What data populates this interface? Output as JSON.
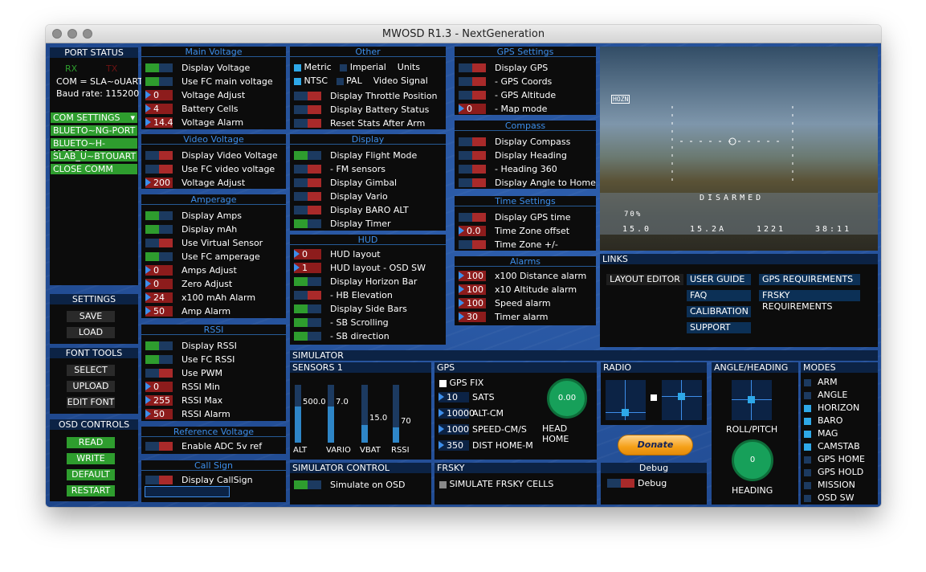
{
  "window": {
    "title": "MWOSD R1.3 - NextGeneration"
  },
  "port": {
    "title": "PORT STATUS",
    "rx": "RX",
    "tx": "TX",
    "com": "COM = SLA~oUART",
    "baud": "Baud rate: 115200",
    "com_settings": "COM SETTINGS",
    "ports": [
      "BLUETO~NG-PORT",
      "BLUETO~H-MODEM",
      "SLAB_U~BTOUART",
      "CLOSE COMM"
    ]
  },
  "settings": {
    "title": "SETTINGS",
    "save": "SAVE",
    "load": "LOAD"
  },
  "font_tools": {
    "title": "FONT TOOLS",
    "select": "SELECT",
    "upload": "UPLOAD",
    "edit": "EDIT FONT"
  },
  "osd_controls": {
    "title": "OSD CONTROLS",
    "read": "READ",
    "write": "WRITE",
    "default": "DEFAULT",
    "restart": "RESTART"
  },
  "main_voltage": {
    "title": "Main Voltage",
    "rows": [
      {
        "label": "Display Voltage",
        "state": "on"
      },
      {
        "label": "Use FC main voltage",
        "state": "on"
      },
      {
        "label": "Voltage Adjust",
        "value": "0"
      },
      {
        "label": "Battery Cells",
        "value": "4"
      },
      {
        "label": "Voltage Alarm",
        "value": "14.4"
      }
    ]
  },
  "video_voltage": {
    "title": "Video Voltage",
    "rows": [
      {
        "label": "Display Video Voltage",
        "state": "off"
      },
      {
        "label": "Use FC video voltage",
        "state": "off"
      },
      {
        "label": "Voltage Adjust",
        "value": "200"
      }
    ]
  },
  "amperage": {
    "title": "Amperage",
    "rows": [
      {
        "label": "Display Amps",
        "state": "on"
      },
      {
        "label": "Display mAh",
        "state": "on"
      },
      {
        "label": "Use Virtual Sensor",
        "state": "off"
      },
      {
        "label": "Use FC amperage",
        "state": "on"
      },
      {
        "label": "Amps Adjust",
        "value": "0"
      },
      {
        "label": "Zero Adjust",
        "value": "0"
      },
      {
        "label": "x100 mAh Alarm",
        "value": "24"
      },
      {
        "label": "Amp Alarm",
        "value": "50"
      }
    ]
  },
  "rssi": {
    "title": "RSSI",
    "rows": [
      {
        "label": "Display RSSI",
        "state": "on"
      },
      {
        "label": "Use FC RSSI",
        "state": "on"
      },
      {
        "label": "Use PWM",
        "state": "off"
      },
      {
        "label": "RSSI Min",
        "value": "0"
      },
      {
        "label": "RSSI Max",
        "value": "255"
      },
      {
        "label": "RSSI Alarm",
        "value": "50"
      }
    ]
  },
  "ref_voltage": {
    "title": "Reference Voltage",
    "rows": [
      {
        "label": "Enable ADC 5v ref",
        "state": "off"
      }
    ]
  },
  "callsign": {
    "title": "Call Sign",
    "rows": [
      {
        "label": "Display CallSign",
        "state": "off"
      }
    ],
    "input": ""
  },
  "other": {
    "title": "Other",
    "metric": "Metric",
    "imperial": "Imperial",
    "units": "Units",
    "ntsc": "NTSC",
    "pal": "PAL",
    "video_signal": "Video Signal",
    "rows": [
      {
        "label": "Display Throttle Position",
        "state": "off"
      },
      {
        "label": "Display Battery Status",
        "state": "off"
      },
      {
        "label": "Reset Stats After Arm",
        "state": "off"
      }
    ]
  },
  "display": {
    "title": "Display",
    "rows": [
      {
        "label": "Display Flight Mode",
        "state": "on"
      },
      {
        "label": " - FM sensors",
        "state": "off"
      },
      {
        "label": "Display Gimbal",
        "state": "off"
      },
      {
        "label": "Display Vario",
        "state": "off"
      },
      {
        "label": "Display BARO ALT",
        "state": "off"
      },
      {
        "label": "Display Timer",
        "state": "on"
      }
    ]
  },
  "hud": {
    "title": "HUD",
    "rows": [
      {
        "label": "HUD layout",
        "value": "0"
      },
      {
        "label": "HUD layout - OSD SW",
        "value": "1"
      },
      {
        "label": "Display Horizon Bar",
        "state": "on"
      },
      {
        "label": " - HB Elevation",
        "state": "off"
      },
      {
        "label": "Display Side Bars",
        "state": "on"
      },
      {
        "label": " - SB Scrolling",
        "state": "on"
      },
      {
        "label": " - SB direction",
        "state": "on"
      }
    ]
  },
  "gps_settings": {
    "title": "GPS Settings",
    "rows": [
      {
        "label": "Display GPS",
        "state": "off"
      },
      {
        "label": " - GPS Coords",
        "state": "off"
      },
      {
        "label": " - GPS Altitude",
        "state": "off"
      },
      {
        "label": " - Map mode",
        "value": "0"
      }
    ]
  },
  "compass": {
    "title": "Compass",
    "rows": [
      {
        "label": "Display Compass",
        "state": "off"
      },
      {
        "label": "Display Heading",
        "state": "off"
      },
      {
        "label": " - Heading 360",
        "state": "off"
      },
      {
        "label": "Display Angle to Home",
        "state": "off"
      }
    ]
  },
  "time_settings": {
    "title": "Time Settings",
    "rows": [
      {
        "label": "Display GPS time",
        "state": "off"
      },
      {
        "label": "Time Zone offset",
        "value": "0.0"
      },
      {
        "label": "Time Zone +/-",
        "state": "off"
      }
    ]
  },
  "alarms": {
    "title": "Alarms",
    "rows": [
      {
        "label": "x100 Distance alarm",
        "value": "100"
      },
      {
        "label": "x10  Altitude alarm",
        "value": "100"
      },
      {
        "label": "Speed alarm",
        "value": "100"
      },
      {
        "label": "Timer alarm",
        "value": "30"
      }
    ]
  },
  "preview": {
    "mode": "HOZN",
    "disarmed": "DISARMED",
    "rssi": "70%",
    "volts": "15.0",
    "amps": "15.2A",
    "mah": "1221",
    "timer": "38:11"
  },
  "links": {
    "title": "LINKS",
    "layout_editor": "LAYOUT EDITOR",
    "user_guide": "USER GUIDE",
    "faq": "FAQ",
    "calibration": "CALIBRATION",
    "support": "SUPPORT",
    "gps_req": "GPS REQUIREMENTS",
    "frsky_req": "FRSKY REQUIREMENTS"
  },
  "simulator": {
    "title": "SIMULATOR",
    "sensors": {
      "title": "SENSORS 1",
      "labels": [
        "ALT",
        "VARIO",
        "VBAT",
        "RSSI"
      ],
      "values": [
        "500.0",
        "7.0",
        "15.0",
        "70"
      ],
      "levels": [
        0.62,
        0.62,
        0.3,
        0.27
      ]
    },
    "gps": {
      "title": "GPS",
      "fix": "GPS FIX",
      "rows": [
        {
          "label": "SATS",
          "value": "10"
        },
        {
          "label": "ALT-CM",
          "value": "10000"
        },
        {
          "label": "SPEED-CM/S",
          "value": "1000"
        },
        {
          "label": "DIST HOME-M",
          "value": "350"
        }
      ],
      "head_home": "HEAD HOME",
      "dial": "0.00"
    },
    "radio": {
      "title": "RADIO"
    },
    "angle": {
      "title": "ANGLE/HEADING",
      "roll_pitch": "ROLL/PITCH",
      "heading": "HEADING",
      "dial": "0"
    },
    "modes": {
      "title": "MODES",
      "items": [
        {
          "label": "ARM",
          "on": false
        },
        {
          "label": "ANGLE",
          "on": false
        },
        {
          "label": "HORIZON",
          "on": true
        },
        {
          "label": "BARO",
          "on": true
        },
        {
          "label": "MAG",
          "on": true
        },
        {
          "label": "CAMSTAB",
          "on": true
        },
        {
          "label": "GPS HOME",
          "on": false
        },
        {
          "label": "GPS HOLD",
          "on": false
        },
        {
          "label": "MISSION",
          "on": false
        },
        {
          "label": "OSD SW",
          "on": false
        }
      ]
    },
    "control": {
      "title": "SIMULATOR CONTROL",
      "rows": [
        {
          "label": "Simulate on OSD",
          "state": "on"
        }
      ]
    },
    "frsky": {
      "title": "FRSKY",
      "cells": "SIMULATE FRSKY CELLS"
    },
    "donate": "Donate",
    "debug": {
      "title": "Debug",
      "rows": [
        {
          "label": "Debug",
          "state": "off"
        }
      ]
    }
  },
  "colors": {
    "accent": "#3d8eea",
    "on": "#2e9d2e",
    "off": "#a92a2a",
    "bg": "#23509a"
  }
}
